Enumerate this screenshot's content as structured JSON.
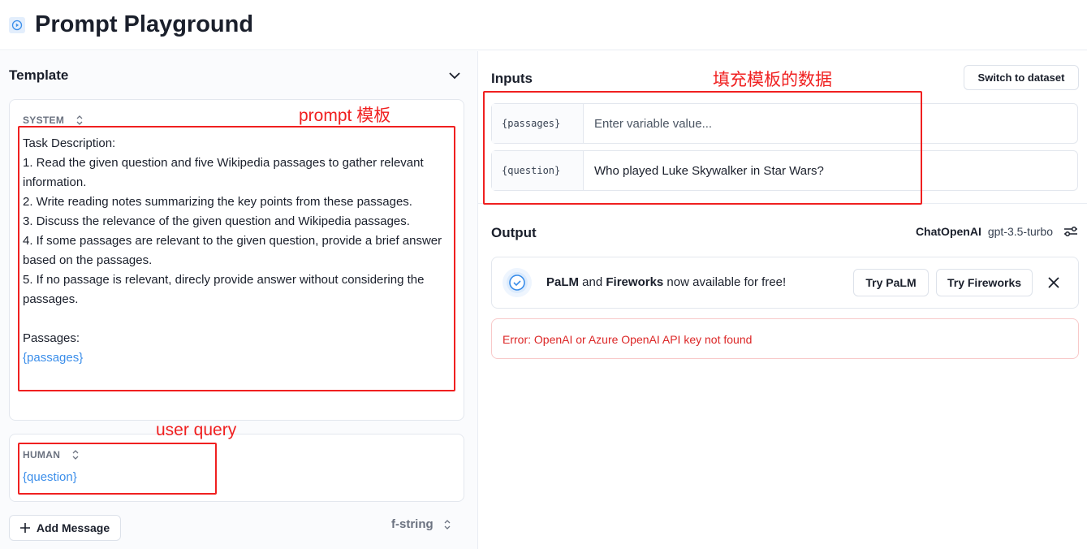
{
  "header": {
    "title": "Prompt Playground",
    "icon": "play-circle-icon"
  },
  "template": {
    "title": "Template",
    "system": {
      "role": "SYSTEM",
      "text": "Task Description:\n1. Read the given question and five Wikipedia passages to gather relevant information.\n2. Write reading notes summarizing the key points from these passages.\n3. Discuss the relevance of the given question and Wikipedia passages.\n4. If some passages are relevant to the given question, provide a brief answer based on the passages.\n5. If no passage is relevant, direcly provide answer without considering the passages.\n\nPassages:",
      "variable": "{passages}"
    },
    "human": {
      "role": "HUMAN",
      "variable": "{question}"
    },
    "add_message": "Add Message",
    "format": "f-string"
  },
  "inputs": {
    "title": "Inputs",
    "switch_label": "Switch to dataset",
    "rows": [
      {
        "key": "{passages}",
        "value": "",
        "placeholder": "Enter variable value..."
      },
      {
        "key": "{question}",
        "value": "Who played Luke Skywalker in Star Wars?",
        "placeholder": ""
      }
    ]
  },
  "output": {
    "title": "Output",
    "provider": "ChatOpenAI",
    "model": "gpt-3.5-turbo",
    "banner": {
      "b1": "PaLM",
      "t1": " and ",
      "b2": "Fireworks",
      "t2": " now available for free!",
      "try_palm": "Try PaLM",
      "try_fireworks": "Try Fireworks"
    },
    "error": "Error: OpenAI or Azure OpenAI API key not found"
  },
  "annotations": {
    "prompt": "prompt 模板",
    "query": "user query",
    "inputs": "填充模板的数据"
  },
  "colors": {
    "accent": "#3b8eea",
    "error": "#dc2626",
    "annotation": "#f02020"
  }
}
